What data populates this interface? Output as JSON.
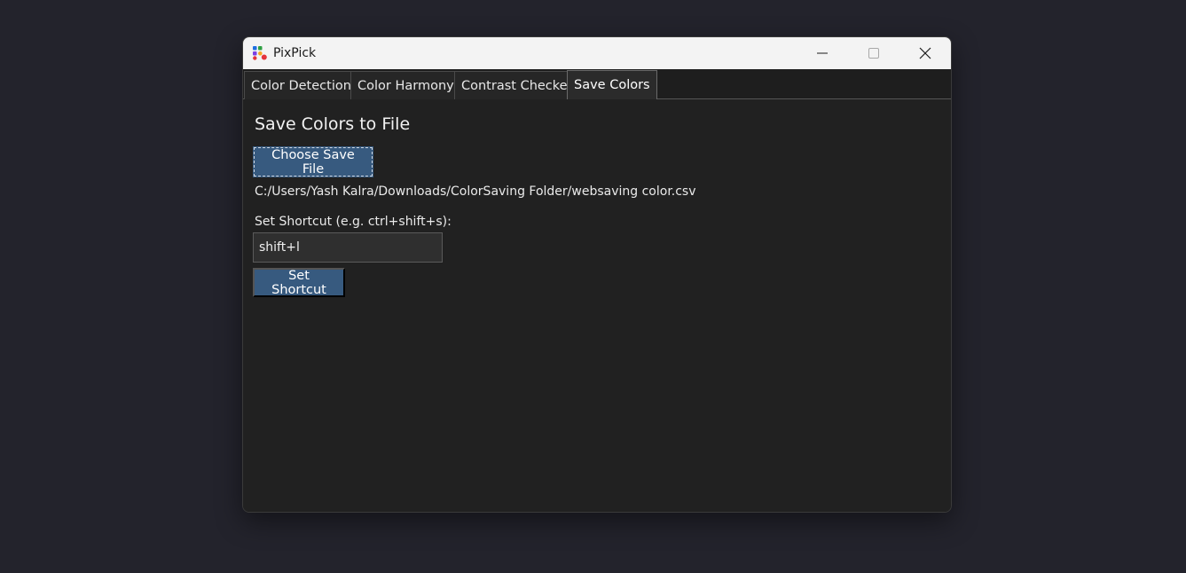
{
  "window": {
    "title": "PixPick"
  },
  "tabs": [
    {
      "label": "Color Detection",
      "active": false
    },
    {
      "label": "Color Harmony",
      "active": false
    },
    {
      "label": "Contrast Checker",
      "active": false
    },
    {
      "label": "Save Colors",
      "active": true
    }
  ],
  "save_colors": {
    "heading": "Save Colors to File",
    "choose_button": "Choose Save File",
    "file_path": "C:/Users/Yash Kalra/Downloads/ColorSaving Folder/websaving color.csv",
    "shortcut_label": "Set Shortcut (e.g. ctrl+shift+s):",
    "shortcut_value": "shift+l",
    "set_button": "Set Shortcut"
  },
  "icons": {
    "app": "pixpick-logo-icon",
    "minimize": "minimize-icon",
    "maximize": "maximize-icon",
    "close": "close-icon"
  },
  "colors": {
    "accent": "#375a7f",
    "background": "#212121",
    "titlebar": "#f3f3f3",
    "desktop": "#23232c"
  }
}
